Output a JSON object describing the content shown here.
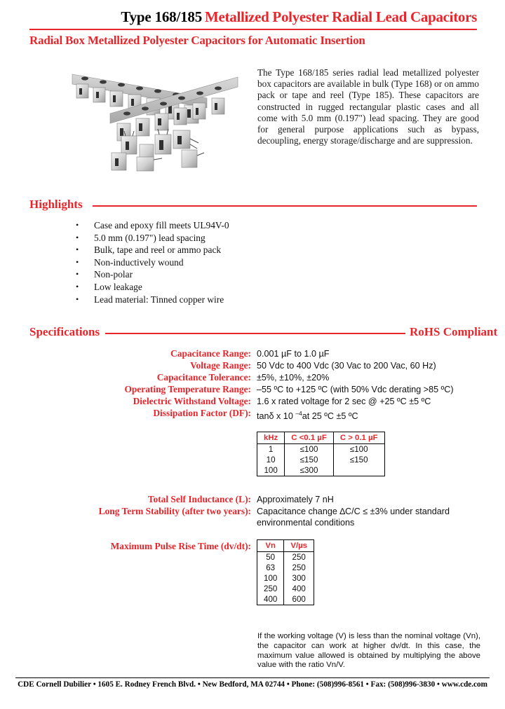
{
  "header": {
    "type_label": "Type 168/185",
    "title": "Metallized Polyester Radial Lead Capacitors",
    "subtitle": "Radial Box Metallized Polyester Capacitors for Automatic Insertion"
  },
  "intro": {
    "paragraph": "The Type 168/185 series radial lead metallized polyester box capacitors are available in bulk (Type 168) or on ammo pack or tape and reel (Type 185). These capacitors are constructed in  rugged rectangular plastic cases and all come with 5.0 mm (0.197\") lead spacing.  They are good  for general purpose applications such as bypass, decoupling, energy storage/discharge and are suppression."
  },
  "highlights": {
    "heading": "Highlights",
    "bullet": "•",
    "items": [
      "Case and epoxy fill meets UL94V-0",
      "5.0 mm (0.197\") lead spacing",
      "Bulk, tape and reel or ammo pack",
      "Non-inductively wound",
      "Non-polar",
      "Low leakage",
      "Lead material:  Tinned copper wire"
    ]
  },
  "specifications": {
    "heading": "Specifications",
    "rohs": "RoHS Compliant",
    "rows": [
      {
        "label": "Capacitance Range:",
        "value": "0.001 µF to 1.0 µF"
      },
      {
        "label": "Voltage Range:",
        "value": "50 Vdc to 400 Vdc (30 Vac to 200 Vac, 60 Hz)"
      },
      {
        "label": "Capacitance Tolerance:",
        "value": "±5%, ±10%, ±20%"
      },
      {
        "label": "Operating Temperature Range:",
        "value": "–55 ºC to +125 ºC (with 50% Vdc derating >85 ºC)"
      },
      {
        "label": "Dielectric Withstand Voltage:",
        "value": "1.6 x rated voltage for 2 sec @ +25 ºC ±5 ºC"
      }
    ],
    "dissipation": {
      "label": "Dissipation Factor (DF):",
      "value_prefix": "tanδ x 10 ",
      "value_sup": "–4",
      "value_suffix": "at 25 ºC ±5 ºC"
    },
    "inductance": {
      "label": "Total Self Inductance (L):",
      "value": "Approximately 7 nH"
    },
    "stability": {
      "label": "Long Term Stability (after two years):",
      "value": "Capacitance change ∆C/C ≤ ±3%  under standard environmental conditions"
    },
    "pulse": {
      "label": "Maximum Pulse Rise Time (dv/dt):"
    }
  },
  "df_table": {
    "headers": [
      "kHz",
      "C <0.1 µF",
      "C > 0.1 µF"
    ],
    "rows": [
      [
        "1",
        "≤100",
        "≤100"
      ],
      [
        "10",
        "≤150",
        "≤150"
      ],
      [
        "100",
        "≤300",
        ""
      ]
    ]
  },
  "vn_table": {
    "headers": [
      "Vn",
      "V/µs"
    ],
    "rows": [
      [
        "50",
        "250"
      ],
      [
        "63",
        "250"
      ],
      [
        "100",
        "300"
      ],
      [
        "250",
        "400"
      ],
      [
        "400",
        "600"
      ]
    ]
  },
  "note": {
    "text": "If the working voltage (V) is less than the nominal voltage (Vn), the capacitor can work at higher dv/dt.  In this case, the maximum value allowed is obtained by multiplying the above value with the ratio Vn/V."
  },
  "footer": {
    "text": "CDE Cornell Dubilier • 1605 E. Rodney French Blvd. • New Bedford, MA 02744 • Phone: (508)996-8561 • Fax: (508)996-3830 • www.cde.com"
  },
  "colors": {
    "accent_red": "#e8252a",
    "text_black": "#111111"
  }
}
